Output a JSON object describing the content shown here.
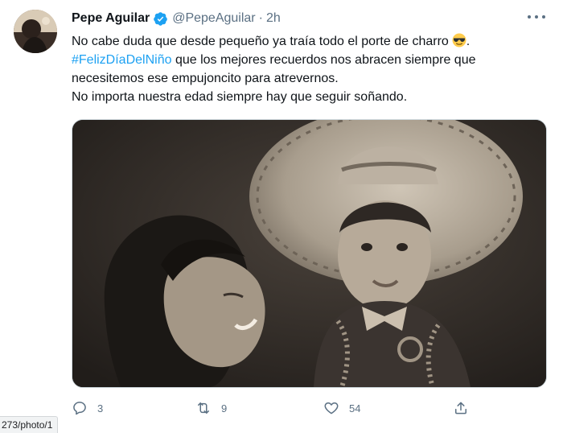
{
  "tweet": {
    "author": {
      "display_name": "Pepe Aguilar",
      "handle": "@PepeAguilar",
      "verified": true,
      "avatar_icon": "user-avatar"
    },
    "separator": "·",
    "time": "2h",
    "more_icon": "more-horizontal-icon",
    "text": {
      "line1": "No cabe duda que desde pequeño ya traía todo el porte de charro",
      "line1_end": ".",
      "emoji": "smiling-face-with-sunglasses",
      "hashtag": "#FelizDíaDelNiño",
      "line2_rest": " que los mejores recuerdos nos abracen siempre que",
      "line3": "necesitemos ese empujoncito para atrevernos.",
      "line4": "No importa nuestra edad siempre hay que seguir soñando."
    },
    "media": {
      "type": "photo",
      "style": "sepia vintage photograph",
      "alt": ""
    },
    "actions": {
      "reply": {
        "icon": "reply-icon",
        "count": "3"
      },
      "retweet": {
        "icon": "retweet-icon",
        "count": "9"
      },
      "like": {
        "icon": "heart-icon",
        "count": "54"
      },
      "share": {
        "icon": "share-icon",
        "count": ""
      }
    }
  },
  "browser": {
    "status_url": "273/photo/1"
  },
  "colors": {
    "accent": "#1da1f2",
    "secondary_text": "#5b7083",
    "primary_text": "#0f1419",
    "border": "#cfd9de"
  }
}
